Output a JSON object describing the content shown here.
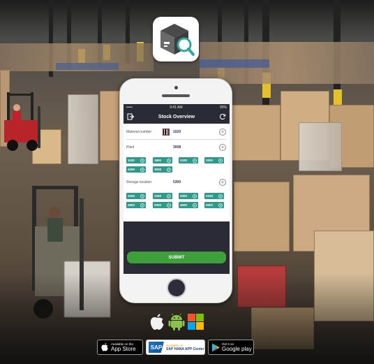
{
  "status_bar": {
    "signal": "•••••",
    "time": "9:41 AM",
    "battery": "90%"
  },
  "screen": {
    "title": "Stock Overview",
    "fields": {
      "material": {
        "label": "Material number",
        "value": "1020"
      },
      "plant": {
        "label": "Plant",
        "value": "3008"
      },
      "storage": {
        "label": "Storage location",
        "value": "5300"
      }
    },
    "plant_chips": [
      "1100",
      "1800",
      "2100",
      "3300",
      "4200",
      "3008"
    ],
    "storage_chips": [
      "1000",
      "1200",
      "2000",
      "3100",
      "4900",
      "2000",
      "4000",
      "5300"
    ],
    "submit_label": "SUBMIT"
  },
  "icons": {
    "app_icon": "box-search-icon",
    "exit": "exit-icon",
    "refresh": "refresh-icon",
    "apple": "apple-icon",
    "android": "android-icon",
    "windows": "windows-icon"
  },
  "badges": {
    "app_store": {
      "small": "Available on the",
      "big": "App Store"
    },
    "sap": {
      "small": "Available on",
      "big": "SAP HANA APP Center",
      "mark": "SAP"
    },
    "google_play": {
      "small": "Get it on",
      "big": "Google play"
    }
  },
  "colors": {
    "screen_dark": "#2b2b35",
    "chip_teal": "#2f9a8c",
    "submit_green": "#3f9f3a",
    "android_green": "#8bc34a",
    "win_red": "#f35325",
    "win_green": "#81bc06",
    "win_blue": "#05a6f0",
    "win_yellow": "#ffba08"
  }
}
